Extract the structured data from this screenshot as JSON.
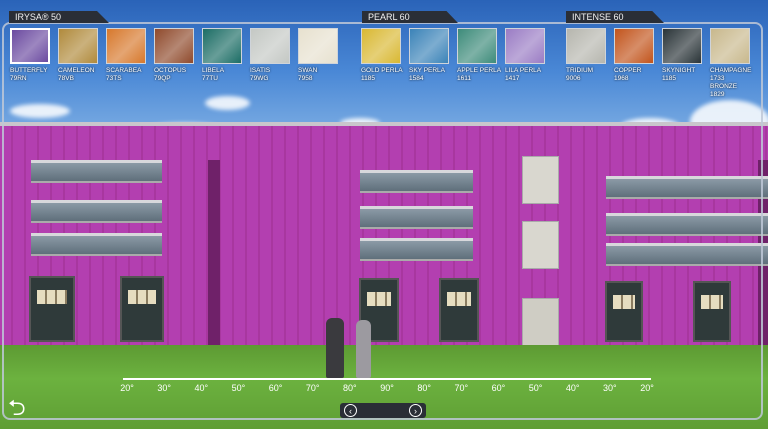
{
  "groups": [
    {
      "title": "IRYSA® 50"
    },
    {
      "title": "PEARL 60"
    },
    {
      "title": "INTENSE 60"
    }
  ],
  "swatches": [
    {
      "name": "BUTTERFLY",
      "code": "79RN",
      "color": "#6b4aa0",
      "selected": true
    },
    {
      "name": "CAMELEON",
      "code": "78VB",
      "color": "#b08a3c"
    },
    {
      "name": "SCARABEA",
      "code": "73TS",
      "color": "#d7782c"
    },
    {
      "name": "OCTOPUS",
      "code": "79QP",
      "color": "#8f4a2c"
    },
    {
      "name": "LIBELA",
      "code": "77TU",
      "color": "#1c6d65"
    },
    {
      "name": "ISATIS",
      "code": "79WG",
      "color": "#c4c8c4"
    },
    {
      "name": "SWAN",
      "code": "7958",
      "color": "#e7e1cf"
    },
    {
      "name": "GOLD PERLA",
      "code": "1185",
      "color": "#d9b832"
    },
    {
      "name": "SKY PERLA",
      "code": "1584",
      "color": "#3b83b8"
    },
    {
      "name": "APPLE PERLA",
      "code": "1611",
      "color": "#3d8b7a"
    },
    {
      "name": "LILA PERLA",
      "code": "1417",
      "color": "#9a7cc4"
    },
    {
      "name": "TRIDIUM",
      "code": "9006",
      "color": "#b6b6ae"
    },
    {
      "name": "COPPER",
      "code": "1968",
      "color": "#c2541c"
    },
    {
      "name": "SKYNIGHT",
      "code": "1185",
      "color": "#2a3438"
    },
    {
      "name": "CHAMPAGNE",
      "code": "1733",
      "color": "#c8b88c",
      "extra": "BRONZE",
      "extra_code": "1829"
    }
  ],
  "ruler_ticks": [
    "20°",
    "30°",
    "40°",
    "50°",
    "60°",
    "70°",
    "80°",
    "90°",
    "80°",
    "70°",
    "60°",
    "50°",
    "40°",
    "30°",
    "20°"
  ],
  "nav": {
    "prev": "‹",
    "next": "›"
  },
  "back_icon": "⮌",
  "wall_color": "#b33fb0"
}
